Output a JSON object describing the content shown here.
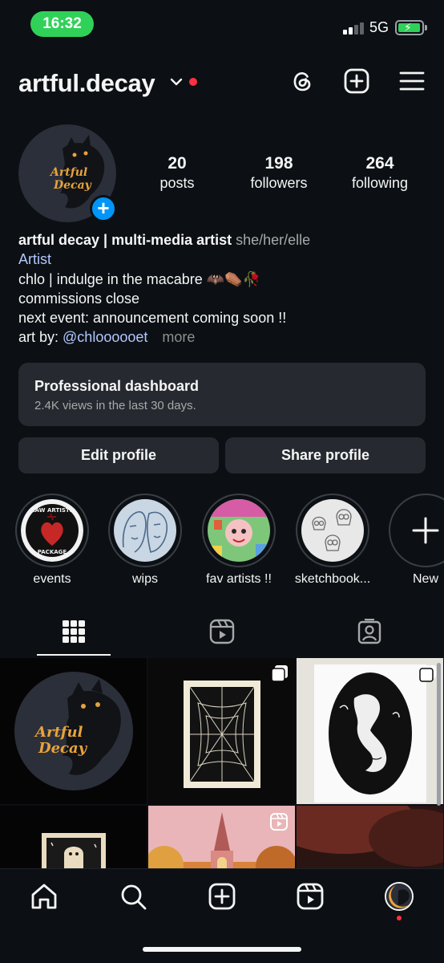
{
  "status_bar": {
    "time": "16:32",
    "network": "5G"
  },
  "header": {
    "username": "artful.decay",
    "icons": [
      "threads-icon",
      "create-icon",
      "menu-icon"
    ]
  },
  "profile": {
    "avatar_text": [
      "Artful",
      "Decay"
    ],
    "stats": [
      {
        "value": "20",
        "label": "posts"
      },
      {
        "value": "198",
        "label": "followers"
      },
      {
        "value": "264",
        "label": "following"
      }
    ],
    "name": "artful decay | multi-media artist",
    "pronouns": "she/her/elle",
    "category": "Artist",
    "bio_line1": "chlo | indulge in the macabre 🦇⚰️🥀",
    "bio_line2": "commissions close",
    "bio_line3": "next event: announcement coming soon !!",
    "bio_line4_prefix": "art by: ",
    "bio_line4_link": "@chloooooet",
    "more": "more"
  },
  "dashboard": {
    "title": "Professional dashboard",
    "subtitle": "2.4K views in the last 30 days."
  },
  "buttons": {
    "edit": "Edit profile",
    "share": "Share profile"
  },
  "highlights": [
    {
      "label": "events",
      "badge_top": "RAW ARTISTS",
      "badge_bottom": "PACKAGE"
    },
    {
      "label": "wips"
    },
    {
      "label": "fav artists !!"
    },
    {
      "label": "sketchbook..."
    },
    {
      "label": "New"
    }
  ],
  "tabs": [
    "grid-tab",
    "reels-tab",
    "tagged-tab"
  ],
  "grid": {
    "posts": [
      {
        "kind": "logo",
        "text": [
          "Artful",
          "Decay"
        ]
      },
      {
        "kind": "spiderweb-print",
        "multi": true
      },
      {
        "kind": "mermaid-print",
        "multi": true
      },
      {
        "kind": "ghost-print"
      },
      {
        "kind": "church-painting",
        "reel": true
      },
      {
        "kind": "red-sky-painting"
      }
    ]
  },
  "colors": {
    "background": "#0c1014",
    "surface": "#262a30",
    "accent": "#0095f6",
    "link": "#b3c7ff",
    "notification": "#ff3040",
    "status_green": "#30d158",
    "moon": "#e8a33b"
  }
}
